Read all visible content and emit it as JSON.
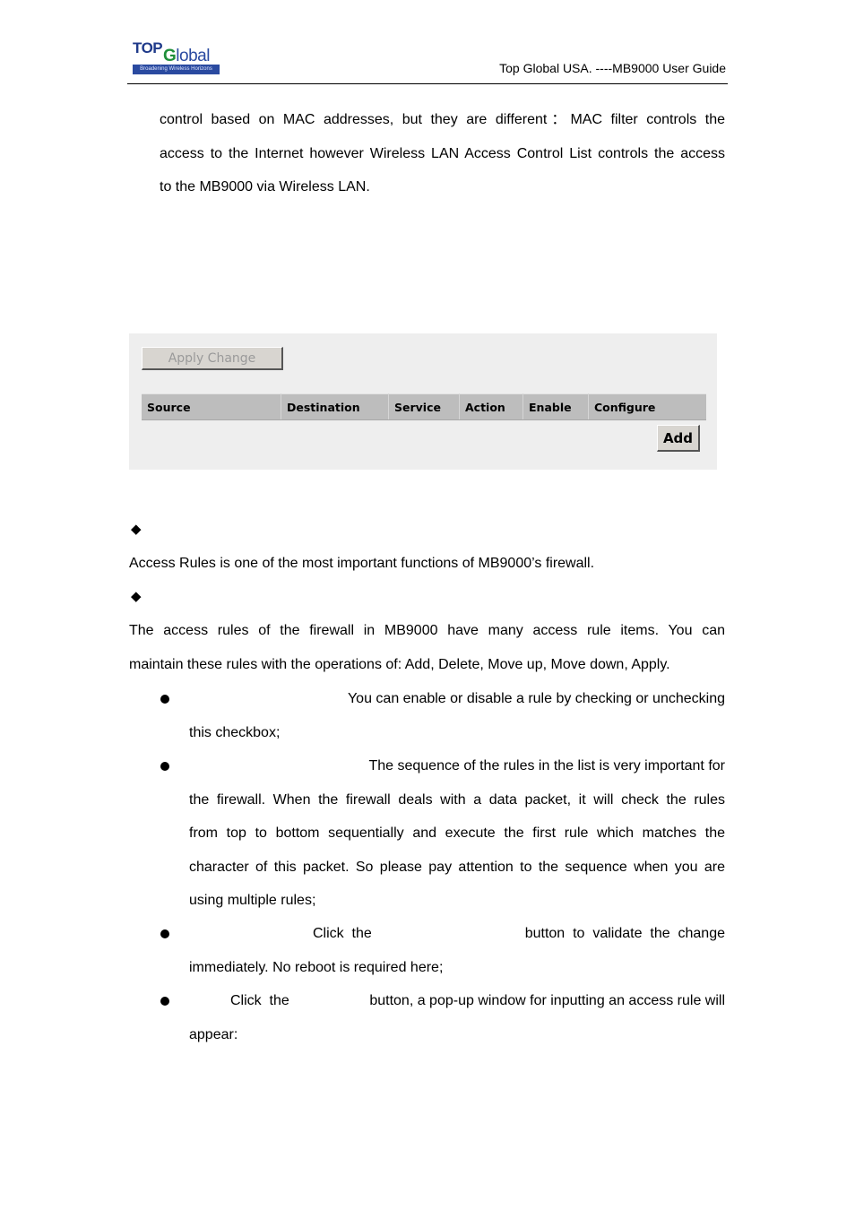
{
  "header": {
    "logo": {
      "top": "TOP",
      "global_first": "G",
      "global_rest": "lobal",
      "tagline": "Broadening Wireless Horizons"
    },
    "title": "Top Global USA. ----MB9000 User Guide"
  },
  "intro": {
    "lines": [
      "control based on MAC addresses, but they are different：MAC filter controls the",
      "access to the Internet however Wireless LAN Access Control List controls the access",
      "to the MB9000 via Wireless LAN."
    ]
  },
  "panel": {
    "apply_button": "Apply Change",
    "columns": [
      "Source",
      "Destination",
      "Service",
      "Action",
      "Enable",
      "Configure"
    ],
    "add_button": "Add"
  },
  "section1": {
    "bullet": "◆",
    "text": "Access Rules is one of the most important functions of MB9000’s firewall."
  },
  "section2": {
    "bullet": "◆",
    "lines": [
      "The access rules of the firewall in MB9000 have many access rule items. You can",
      "maintain these rules with the operations of: Add, Delete, Move up, Move down, Apply."
    ]
  },
  "bullets": [
    {
      "first_line": "You can enable or disable a rule by checking or unchecking",
      "rest": [
        "this checkbox;"
      ]
    },
    {
      "first_line": "The sequence of the rules in the list is very important for",
      "rest": [
        "the firewall. When the firewall deals with a data packet, it will check the rules",
        "from top to bottom sequentially and execute the first rule which matches the",
        "character of this packet. So please pay attention to the sequence when you are",
        "using multiple rules;"
      ]
    },
    {
      "first_line_a": "Click  the",
      "first_line_b": "button  to  validate  the  change",
      "rest": [
        "immediately. No reboot is required here;"
      ]
    },
    {
      "first_line_a": "Click  the",
      "first_line_b": "button, a pop-up window for inputting an access rule will",
      "rest": [
        "appear:"
      ]
    }
  ]
}
